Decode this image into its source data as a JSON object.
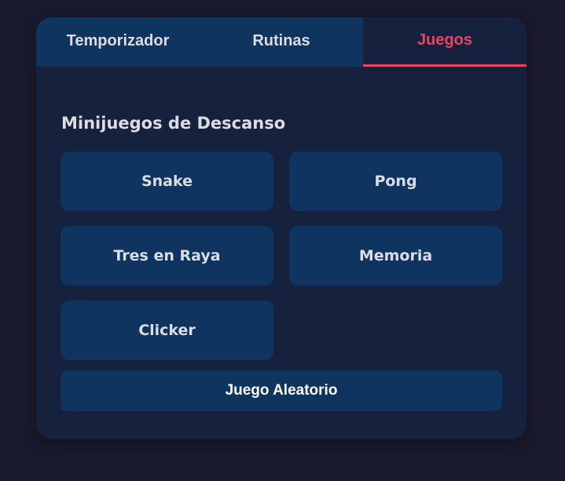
{
  "tabs": [
    {
      "label": "Temporizador",
      "active": false
    },
    {
      "label": "Rutinas",
      "active": false
    },
    {
      "label": "Juegos",
      "active": true
    }
  ],
  "games_section": {
    "title": "Minijuegos de Descanso",
    "games": [
      "Snake",
      "Pong",
      "Tres en Raya",
      "Memoria",
      "Clicker"
    ],
    "random_label": "Juego Aleatorio"
  },
  "colors": {
    "background": "#1a1a2e",
    "card": "#16213e",
    "button": "#0f3460",
    "accent": "#e94560",
    "text": "#dcdde3"
  }
}
